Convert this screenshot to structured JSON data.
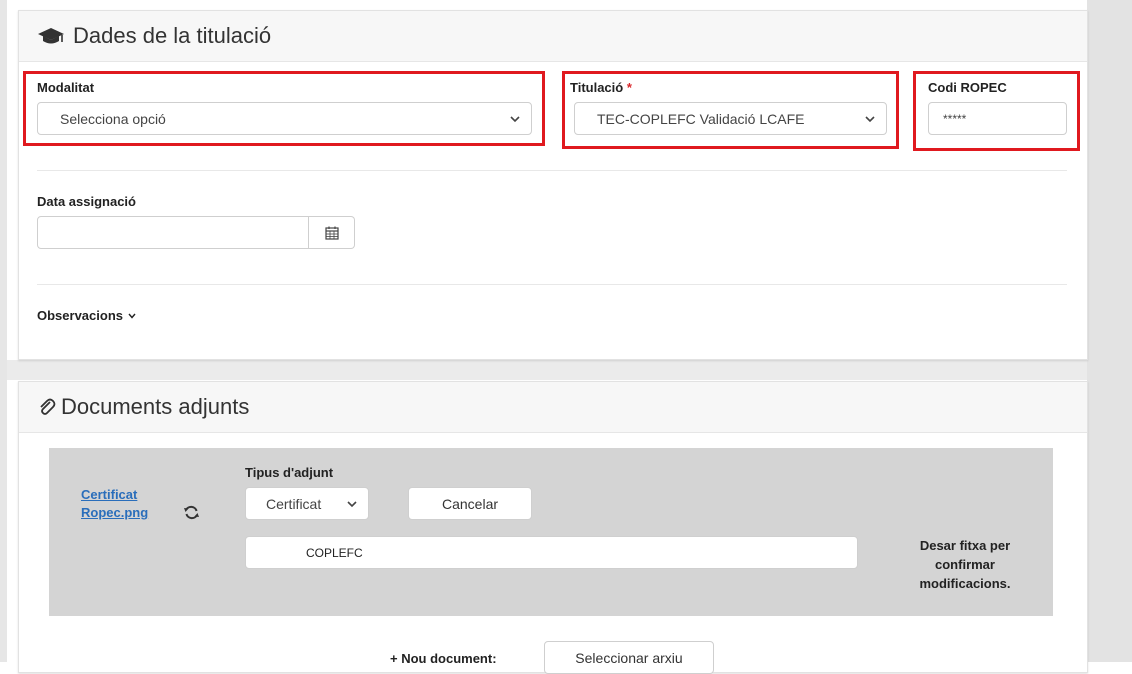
{
  "titulacio_panel": {
    "title": "Dades de la titulació",
    "modalitat": {
      "label": "Modalitat",
      "value": "Selecciona opció"
    },
    "titulacio": {
      "label": "Titulació",
      "required_mark": "*",
      "value": "TEC-COPLEFC Validació LCAFE"
    },
    "codi_ropec": {
      "label": "Codi ROPEC",
      "value": "*****"
    },
    "data_assignacio": {
      "label": "Data assignació",
      "value": ""
    },
    "observacions": {
      "label": "Observacions"
    }
  },
  "documents_panel": {
    "title": "Documents adjunts",
    "attachment": {
      "file_name_line1": "Certificat",
      "file_name_line2": "Ropec.png",
      "tipus_label": "Tipus d'adjunt",
      "tipus_value": "Certificat",
      "cancel_label": "Cancelar",
      "description_value": "COPLEFC",
      "save_note_line1": "Desar fitxa per",
      "save_note_line2": "confirmar",
      "save_note_line3": "modificacions."
    },
    "new_document": {
      "label": "+ Nou document:",
      "button_label": "Seleccionar arxiu"
    }
  },
  "colors": {
    "highlight": "#e0191f",
    "link": "#2a6ebb",
    "required": "#d9262a"
  },
  "icons": [
    "graduation-cap-icon",
    "chevron-down-icon",
    "calendar-icon",
    "paperclip-icon",
    "refresh-icon"
  ]
}
